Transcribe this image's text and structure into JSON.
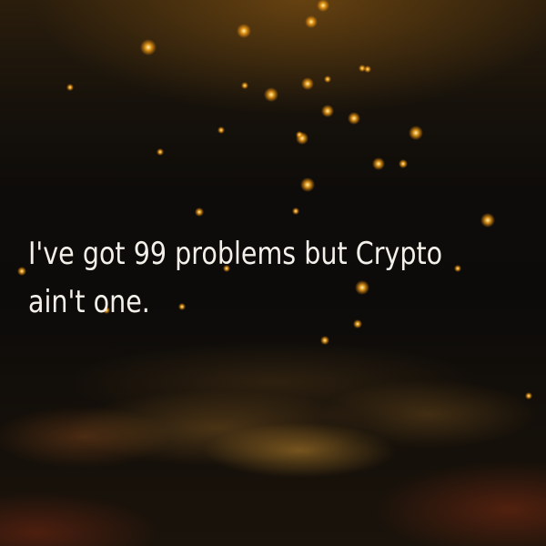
{
  "quote": {
    "line1": "I've got 99 problems but Crypto",
    "line2": "ain't one."
  },
  "colors": {
    "background": "#0b0907",
    "light_glow": "#ffb020",
    "text": "#f3efe9"
  }
}
